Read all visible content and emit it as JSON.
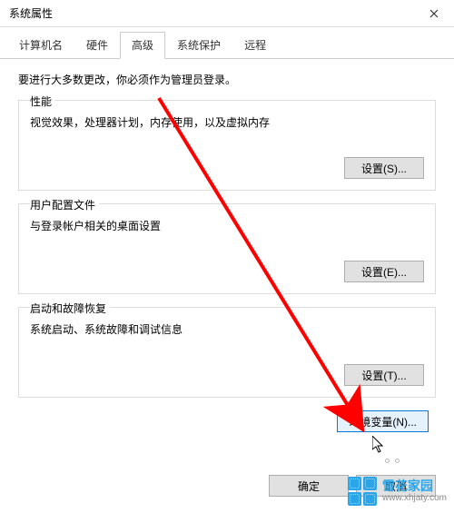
{
  "titlebar": {
    "title": "系统属性"
  },
  "tabs": [
    {
      "label": "计算机名",
      "active": false
    },
    {
      "label": "硬件",
      "active": false
    },
    {
      "label": "高级",
      "active": true
    },
    {
      "label": "系统保护",
      "active": false
    },
    {
      "label": "远程",
      "active": false
    }
  ],
  "content": {
    "notice": "要进行大多数更改，你必须作为管理员登录。",
    "sections": [
      {
        "title": "性能",
        "desc": "视觉效果，处理器计划，内存使用，以及虚拟内存",
        "button": "设置(S)..."
      },
      {
        "title": "用户配置文件",
        "desc": "与登录帐户相关的桌面设置",
        "button": "设置(E)..."
      },
      {
        "title": "启动和故障恢复",
        "desc": "系统启动、系统故障和调试信息",
        "button": "设置(T)..."
      }
    ],
    "env_button": "环境变量(N)..."
  },
  "dialog_buttons": {
    "ok": "确定",
    "cancel": "取消"
  },
  "watermark": {
    "name": "雪花家园",
    "url": "www.xhjaty.com"
  },
  "annotation": {
    "arrow_color": "#ff0000"
  }
}
